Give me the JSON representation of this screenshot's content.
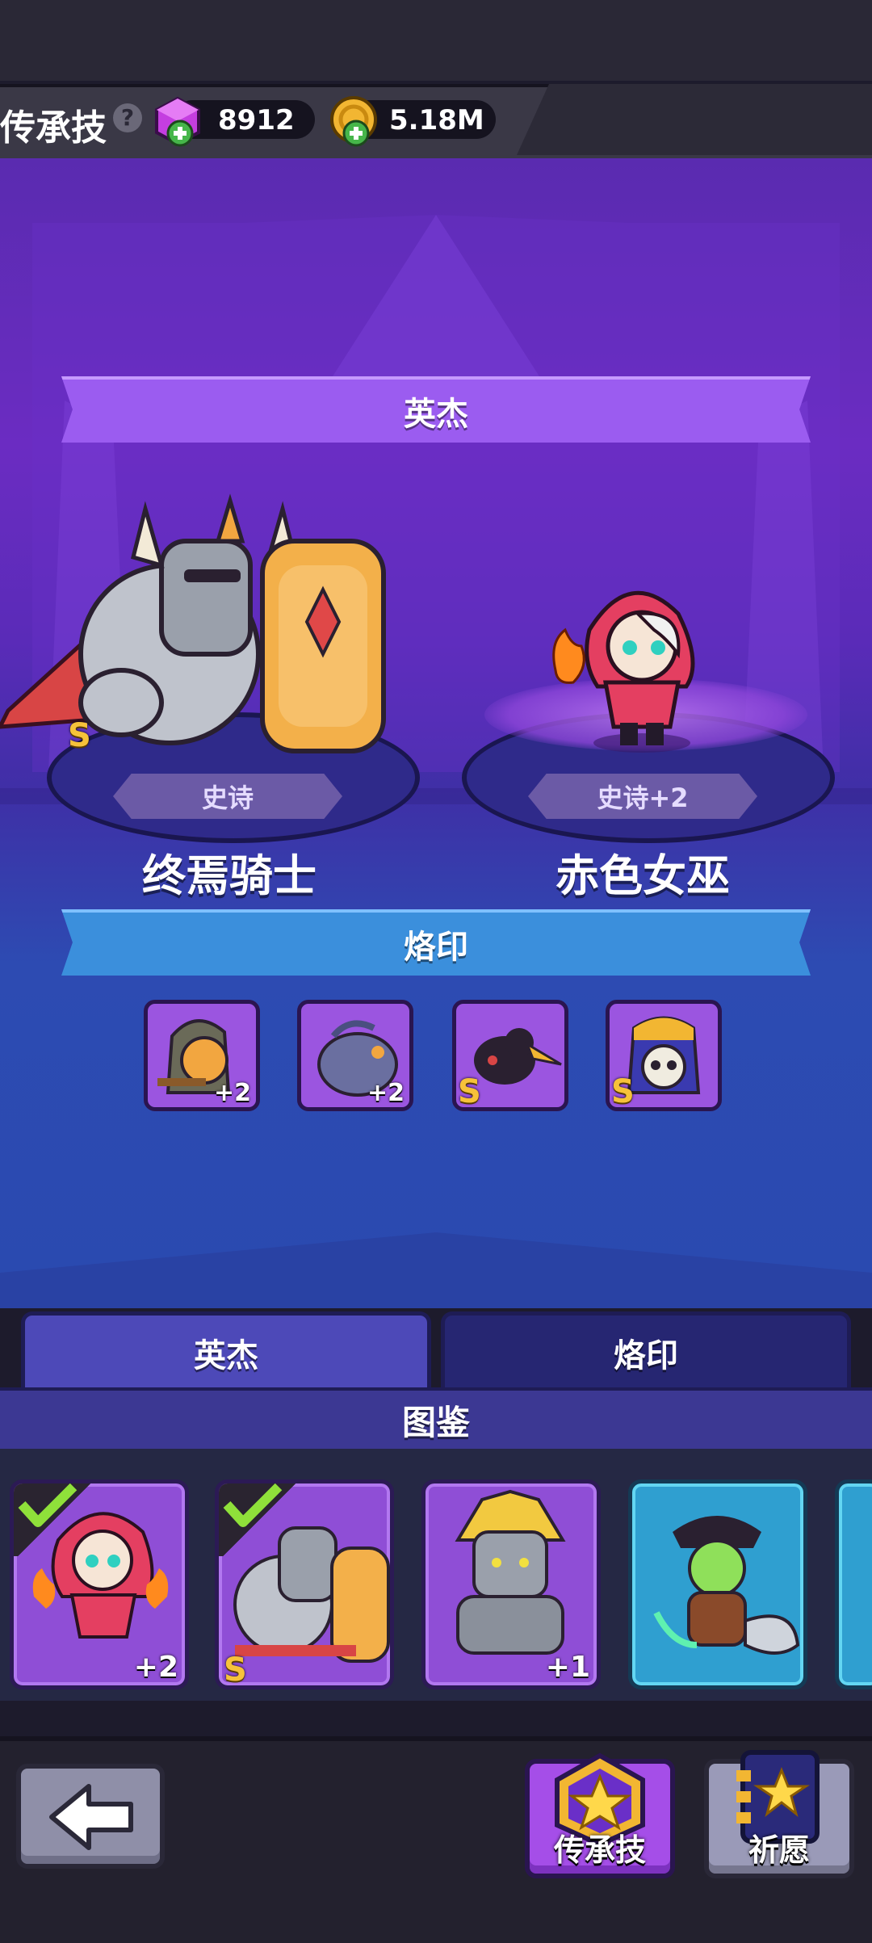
{
  "header": {
    "title": "传承技",
    "gems": "8912",
    "gold": "5.18M"
  },
  "heroes_section": {
    "banner": "英杰",
    "heroes": [
      {
        "rarity": "史诗",
        "name": "终焉骑士",
        "grade": "S"
      },
      {
        "rarity": "史诗+2",
        "name": "赤色女巫"
      }
    ]
  },
  "imprint_section": {
    "banner": "烙印",
    "slots": [
      {
        "level": "+2"
      },
      {
        "level": "+2"
      },
      {
        "grade": "S"
      },
      {
        "grade": "S"
      }
    ]
  },
  "tabs": [
    "英杰",
    "烙印"
  ],
  "codex": {
    "title": "图鉴",
    "cards": [
      {
        "level": "+2"
      },
      {
        "grade": "S"
      },
      {
        "level": "+1"
      },
      {}
    ]
  },
  "bottom": {
    "legacy_label": "传承技",
    "wish_label": "祈愿"
  },
  "colors": {
    "hero_banner": "#9b5cf0",
    "imprint_banner": "#3b8fdc",
    "gem": "#c43ee0",
    "gold": "#f2b632"
  }
}
